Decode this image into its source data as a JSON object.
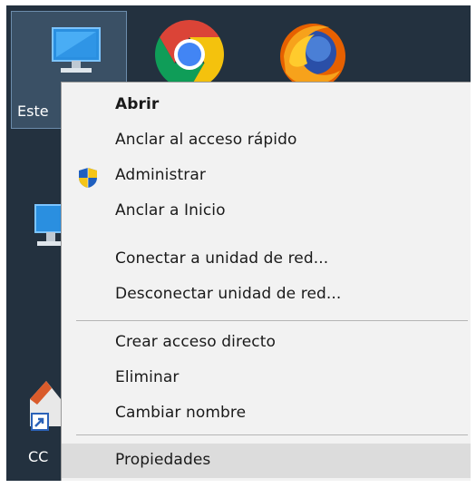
{
  "desktop": {
    "icons": [
      {
        "label": "Este",
        "name": "this-pc"
      },
      {
        "label": "",
        "name": "chrome"
      },
      {
        "label": "",
        "name": "firefox"
      },
      {
        "label": "",
        "name": "network"
      },
      {
        "label": "CC",
        "name": "shortcut"
      }
    ]
  },
  "context_menu": {
    "items": [
      {
        "label": "Abrir",
        "bold": true
      },
      {
        "label": "Anclar al acceso rápido"
      },
      {
        "label": "Administrar",
        "icon": "uac-shield-icon"
      },
      {
        "label": "Anclar a Inicio"
      },
      {
        "label": "Conectar a unidad de red..."
      },
      {
        "label": "Desconectar unidad de red..."
      },
      {
        "label": "Crear acceso directo"
      },
      {
        "label": "Eliminar"
      },
      {
        "label": "Cambiar nombre"
      },
      {
        "label": "Propiedades",
        "highlighted": true
      }
    ]
  },
  "colors": {
    "desktop_background": "#23313f",
    "menu_background": "#f2f2f2",
    "menu_hover": "#dcdcdc",
    "separator": "#b5b5b5",
    "selection": "#78a0c8"
  }
}
